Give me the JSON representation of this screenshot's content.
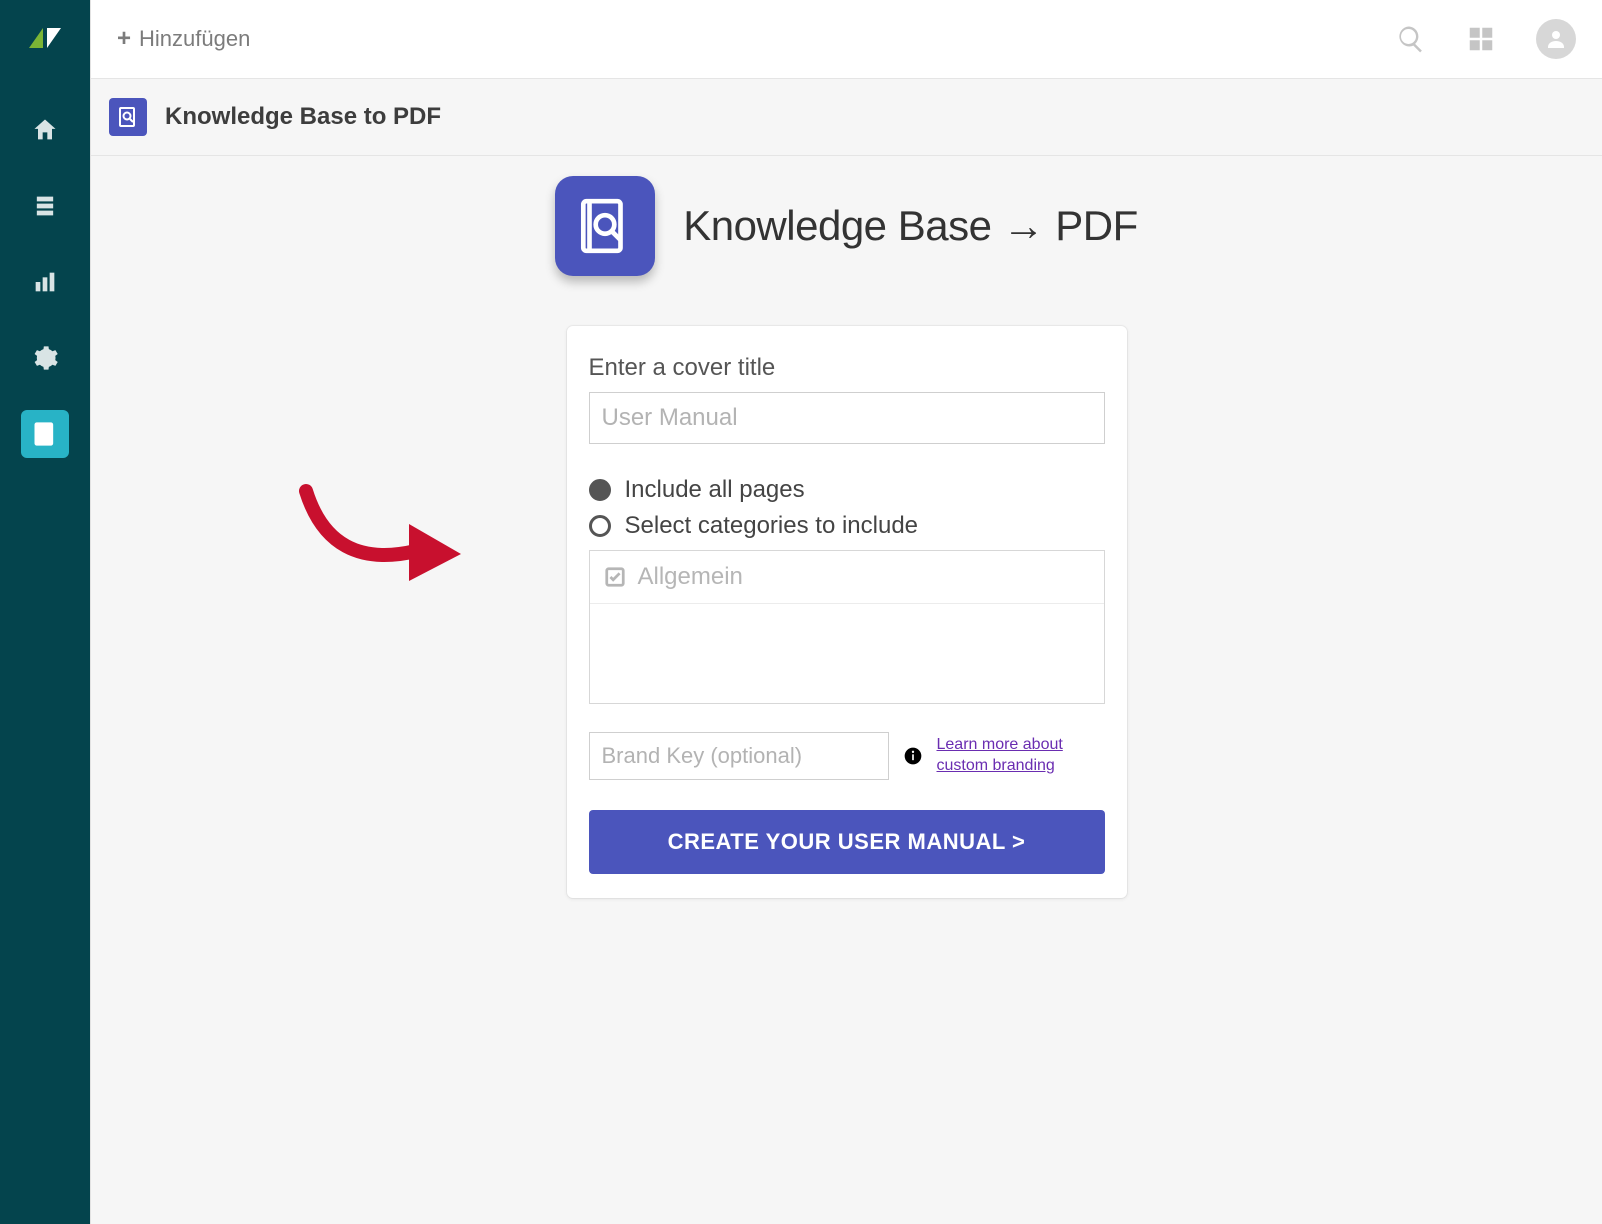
{
  "topbar": {
    "add_label": "Hinzufügen"
  },
  "titlebar": {
    "title": "Knowledge Base to PDF"
  },
  "hero": {
    "title": "Knowledge Base → PDF"
  },
  "form": {
    "cover_title_label": "Enter a cover title",
    "cover_title_placeholder": "User Manual",
    "cover_title_value": "",
    "radio_all_label": "Include all pages",
    "radio_select_label": "Select categories to include",
    "categories": [
      {
        "label": "Allgemein",
        "checked": true
      }
    ],
    "brand_key_placeholder": "Brand Key (optional)",
    "brand_key_value": "",
    "brand_link_text": "Learn more about custom branding",
    "create_button_label": "CREATE YOUR USER MANUAL >"
  },
  "colors": {
    "accent": "#4b55bc",
    "sidebar": "#04444d",
    "active": "#28b3c6",
    "annotation": "#c8102e"
  }
}
